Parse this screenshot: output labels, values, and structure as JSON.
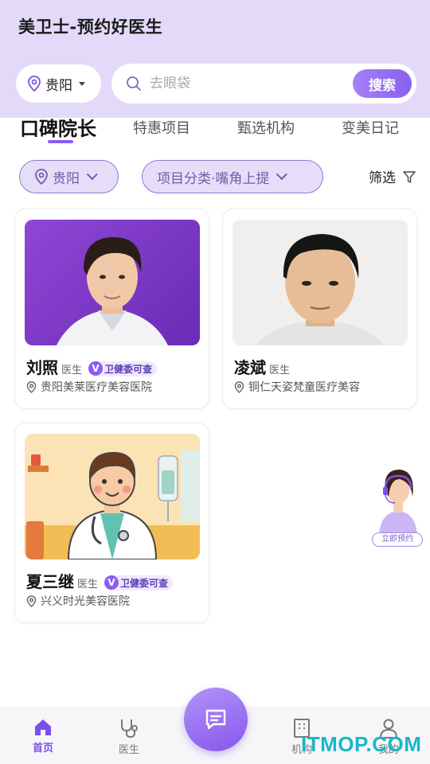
{
  "header": {
    "app_title": "美卫士-预约好医生",
    "city": "贵阳",
    "search_placeholder": "去眼袋",
    "search_button": "搜索"
  },
  "tabs": [
    {
      "label": "口碑院长",
      "active": true
    },
    {
      "label": "特惠项目",
      "active": false
    },
    {
      "label": "甄选机构",
      "active": false
    },
    {
      "label": "变美日记",
      "active": false
    }
  ],
  "filters": {
    "city": "贵阳",
    "category": "项目分类·嘴角上提",
    "screen": "筛选"
  },
  "doctors": [
    {
      "name": "刘照",
      "title": "医生",
      "badge": "卫健委可查",
      "badge_icon": "V",
      "hospital": "贵阳美莱医疗美容医院",
      "photo": "doctor-photo-purple-background"
    },
    {
      "name": "凌斌",
      "title": "医生",
      "badge": "",
      "hospital": "铜仁天姿梵童医疗美容",
      "photo": "doctor-photo-light-background"
    },
    {
      "name": "夏三继",
      "title": "医生",
      "badge": "卫健委可查",
      "badge_icon": "V",
      "hospital": "兴义时光美容医院",
      "photo": "cartoon-doctor-illustration"
    }
  ],
  "floating_consult": {
    "label": "立即预约"
  },
  "bottom_nav": [
    {
      "label": "首页",
      "icon": "home-icon",
      "active": true
    },
    {
      "label": "医生",
      "icon": "stethoscope-icon",
      "active": false
    },
    {
      "label": "",
      "icon": "chat-icon",
      "active": false
    },
    {
      "label": "机构",
      "icon": "building-icon",
      "active": false
    },
    {
      "label": "我的",
      "icon": "user-icon",
      "active": false
    }
  ],
  "watermark": "ITMOP.COM",
  "colors": {
    "header_bg": "#e3dafa",
    "accent": "#8b5cf6",
    "filter_bg": "#e6def9"
  }
}
